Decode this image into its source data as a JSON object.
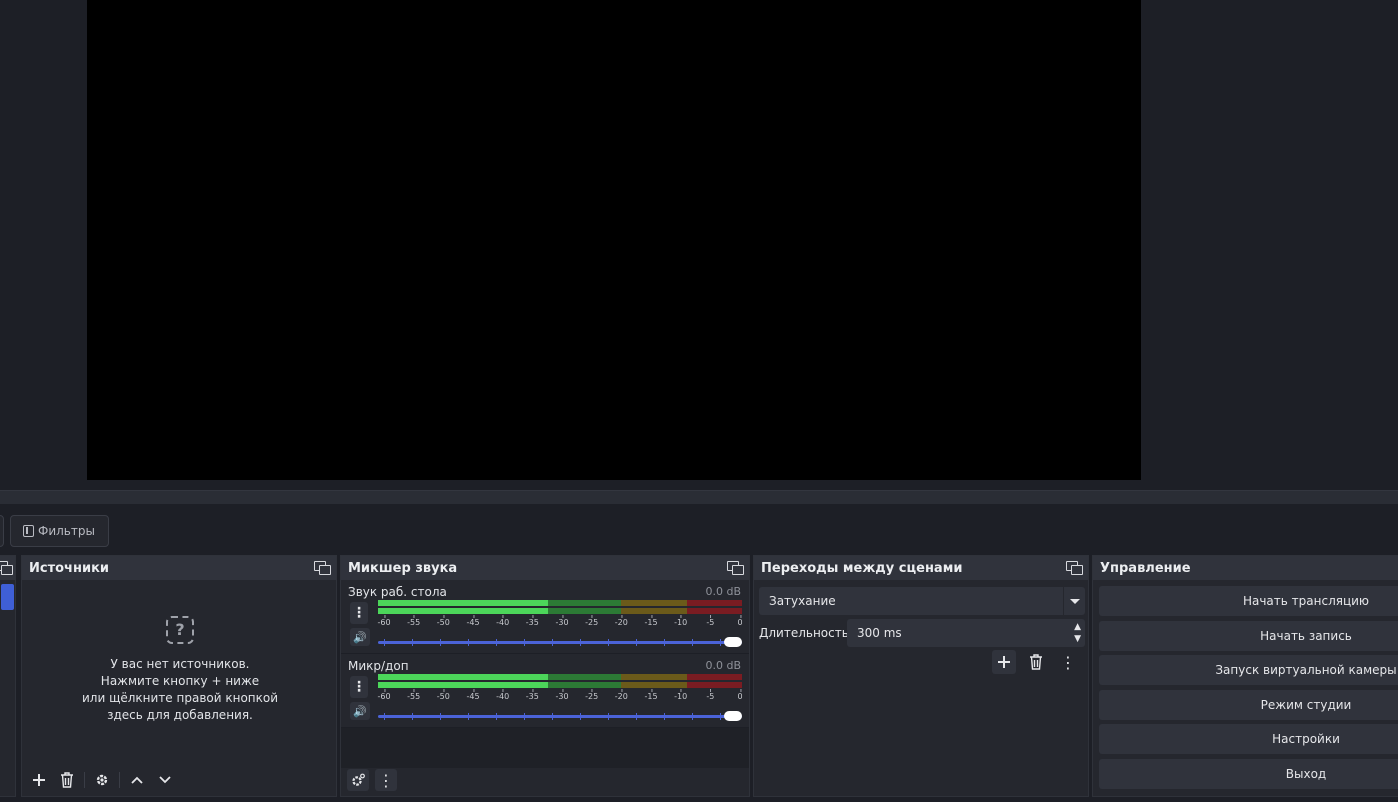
{
  "toolbar": {
    "filters_label": "Фильтры"
  },
  "sources": {
    "title": "Источники",
    "empty_line1": "У вас нет источников.",
    "empty_line2": "Нажмите кнопку + ниже",
    "empty_line3": "или щёлкните правой кнопкой",
    "empty_line4": "здесь для добавления."
  },
  "mixer": {
    "title": "Микшер звука",
    "channels": [
      {
        "name": "Звук раб. стола",
        "db": "0.0 dB",
        "volume_fraction": 1.0
      },
      {
        "name": "Микр/доп",
        "db": "0.0 dB",
        "volume_fraction": 1.0
      }
    ],
    "ticks": [
      "-60",
      "-55",
      "-50",
      "-45",
      "-40",
      "-35",
      "-30",
      "-25",
      "-20",
      "-15",
      "-10",
      "-5",
      "0"
    ]
  },
  "transitions": {
    "title": "Переходы между сценами",
    "selected": "Затухание",
    "duration_label": "Длительность",
    "duration_value": "300 ms"
  },
  "controls": {
    "title": "Управление",
    "buttons": [
      "Начать трансляцию",
      "Начать запись",
      "Запуск виртуальной камеры",
      "Режим студии",
      "Настройки",
      "Выход"
    ]
  },
  "colors": {
    "meter_green": "#4cd65a",
    "meter_yellow": "#b6a12a",
    "meter_red": "#c8262e",
    "slider_blue": "#4b63d8"
  }
}
